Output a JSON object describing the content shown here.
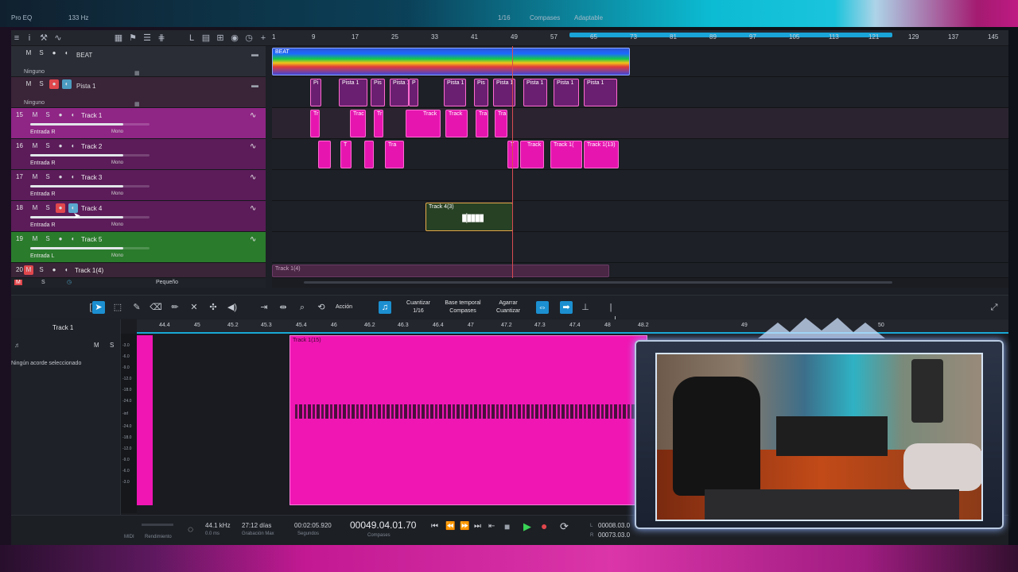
{
  "topbar": {
    "left_label": "Pro EQ",
    "freq": "133 Hz",
    "quantize": "1/16",
    "timebase": "Compases",
    "snap": "Adaptable"
  },
  "ruler": {
    "bars": [
      "1",
      "9",
      "17",
      "25",
      "33",
      "41",
      "49",
      "57",
      "65",
      "73",
      "81",
      "89",
      "97",
      "105",
      "113",
      "121",
      "129",
      "137",
      "145"
    ]
  },
  "folders": [
    {
      "name": "BEAT",
      "sub": "Ninguno"
    },
    {
      "name": "Pista 1",
      "sub": "Ninguno"
    }
  ],
  "tracks": [
    {
      "num": "15",
      "name": "Track 1",
      "input": "Entrada R",
      "mode": "Mono"
    },
    {
      "num": "16",
      "name": "Track 2",
      "input": "Entrada R",
      "mode": "Mono"
    },
    {
      "num": "17",
      "name": "Track 3",
      "input": "Entrada R",
      "mode": "Mono"
    },
    {
      "num": "18",
      "name": "Track 4",
      "input": "Entrada R",
      "mode": "Mono"
    },
    {
      "num": "19",
      "name": "Track 5",
      "input": "Entrada L",
      "mode": "Mono"
    },
    {
      "num": "20",
      "name": "Track 1(4)",
      "input": "",
      "mode": ""
    }
  ],
  "buttons": {
    "mute": "M",
    "solo": "S"
  },
  "clips": {
    "beat": "BEAT",
    "pista": "Pista 1",
    "pista_short": "Pis",
    "pista_p": "P",
    "pista_pi": "Pi",
    "track_tr": "Tr",
    "track_trac": "Trac",
    "track": "Track",
    "track_tra": "Tra",
    "track_t": "T",
    "track_1_1": "Track 1(",
    "track_1_13": "Track 1(13)",
    "track_4_3": "Track 4(3)",
    "track_1_4": "Track 1(4)"
  },
  "bottom_info": {
    "size": "Pequeño"
  },
  "editor": {
    "action_label": "Acción",
    "quantize_label": "Cuantizar",
    "quantize_value": "1/16",
    "timebase_label": "Base temporal",
    "timebase_value": "Compases",
    "add_label": "Agarrar",
    "add_value": "Cuantizar",
    "track_name": "Track 1",
    "chord_text": "Ningún acorde seleccionado",
    "clip_name": "Track 1(15)",
    "ruler": [
      "44.4",
      "45",
      "45.2",
      "45.3",
      "45.4",
      "46",
      "46.2",
      "46.3",
      "46.4",
      "47",
      "47.2",
      "47.3",
      "47.4",
      "48",
      "48.2",
      "49",
      "50"
    ],
    "db_scale": [
      "-3.0",
      "-6.0",
      "-9.0",
      "-12.0",
      "-18.0",
      "-24.0",
      "-inf",
      "-24.0",
      "-18.0",
      "-12.0",
      "-9.0",
      "-6.0",
      "-3.0"
    ]
  },
  "transport": {
    "midi": "MIDI",
    "performance": "Rendimiento",
    "sample_rate": "44.1 kHz",
    "latency": "0.0 ms",
    "rec_time": "27:12 días",
    "rec_label": "Grabación Max",
    "seconds": "00:02:05.920",
    "seconds_label": "Segundos",
    "position": "00049.04.01.70",
    "position_label": "Compases",
    "loop_l": "00008.03.0",
    "loop_r": "00073.03.0",
    "l": "L",
    "r": "R"
  },
  "colors": {
    "accent": "#18a9d6",
    "magenta": "#f016b4",
    "purple": "#7a1d7e",
    "green": "#2c7a2c",
    "record": "#e0474c"
  }
}
